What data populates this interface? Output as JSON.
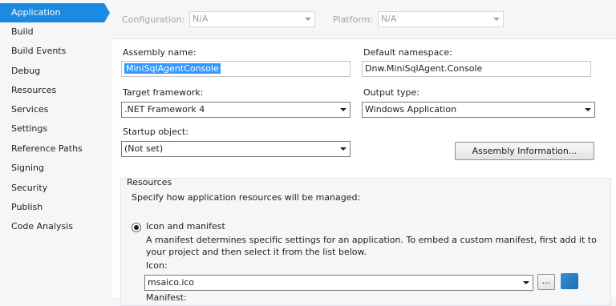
{
  "sidebar": {
    "items": [
      {
        "label": "Application"
      },
      {
        "label": "Build"
      },
      {
        "label": "Build Events"
      },
      {
        "label": "Debug"
      },
      {
        "label": "Resources"
      },
      {
        "label": "Services"
      },
      {
        "label": "Settings"
      },
      {
        "label": "Reference Paths"
      },
      {
        "label": "Signing"
      },
      {
        "label": "Security"
      },
      {
        "label": "Publish"
      },
      {
        "label": "Code Analysis"
      }
    ],
    "selected": "Application",
    "selected_color": "#1a8be0"
  },
  "toolbar": {
    "configuration_label": "Configuration:",
    "configuration_value": "N/A",
    "platform_label": "Platform:",
    "platform_value": "N/A"
  },
  "form": {
    "assembly_name_label": "Assembly name:",
    "assembly_name_value": "MiniSqlAgentConsole",
    "default_namespace_label": "Default namespace:",
    "default_namespace_value": "Dnw.MiniSqlAgent.Console",
    "target_framework_label": "Target framework:",
    "target_framework_value": ".NET Framework 4",
    "output_type_label": "Output type:",
    "output_type_value": "Windows Application",
    "startup_object_label": "Startup object:",
    "startup_object_value": "(Not set)",
    "assembly_info_button": "Assembly Information..."
  },
  "resources": {
    "group_title": "Resources",
    "description": "Specify how application resources will be managed:",
    "icon_manifest_radio": "Icon and manifest",
    "manifest_help_line1": "A manifest determines specific settings for an application. To embed a custom manifest, first add it to",
    "manifest_help_line2": "your project and then select it from the list below.",
    "icon_label": "Icon:",
    "icon_value": "msaico.ico",
    "browse_button": "...",
    "manifest_label_partial": "Manifest:"
  }
}
